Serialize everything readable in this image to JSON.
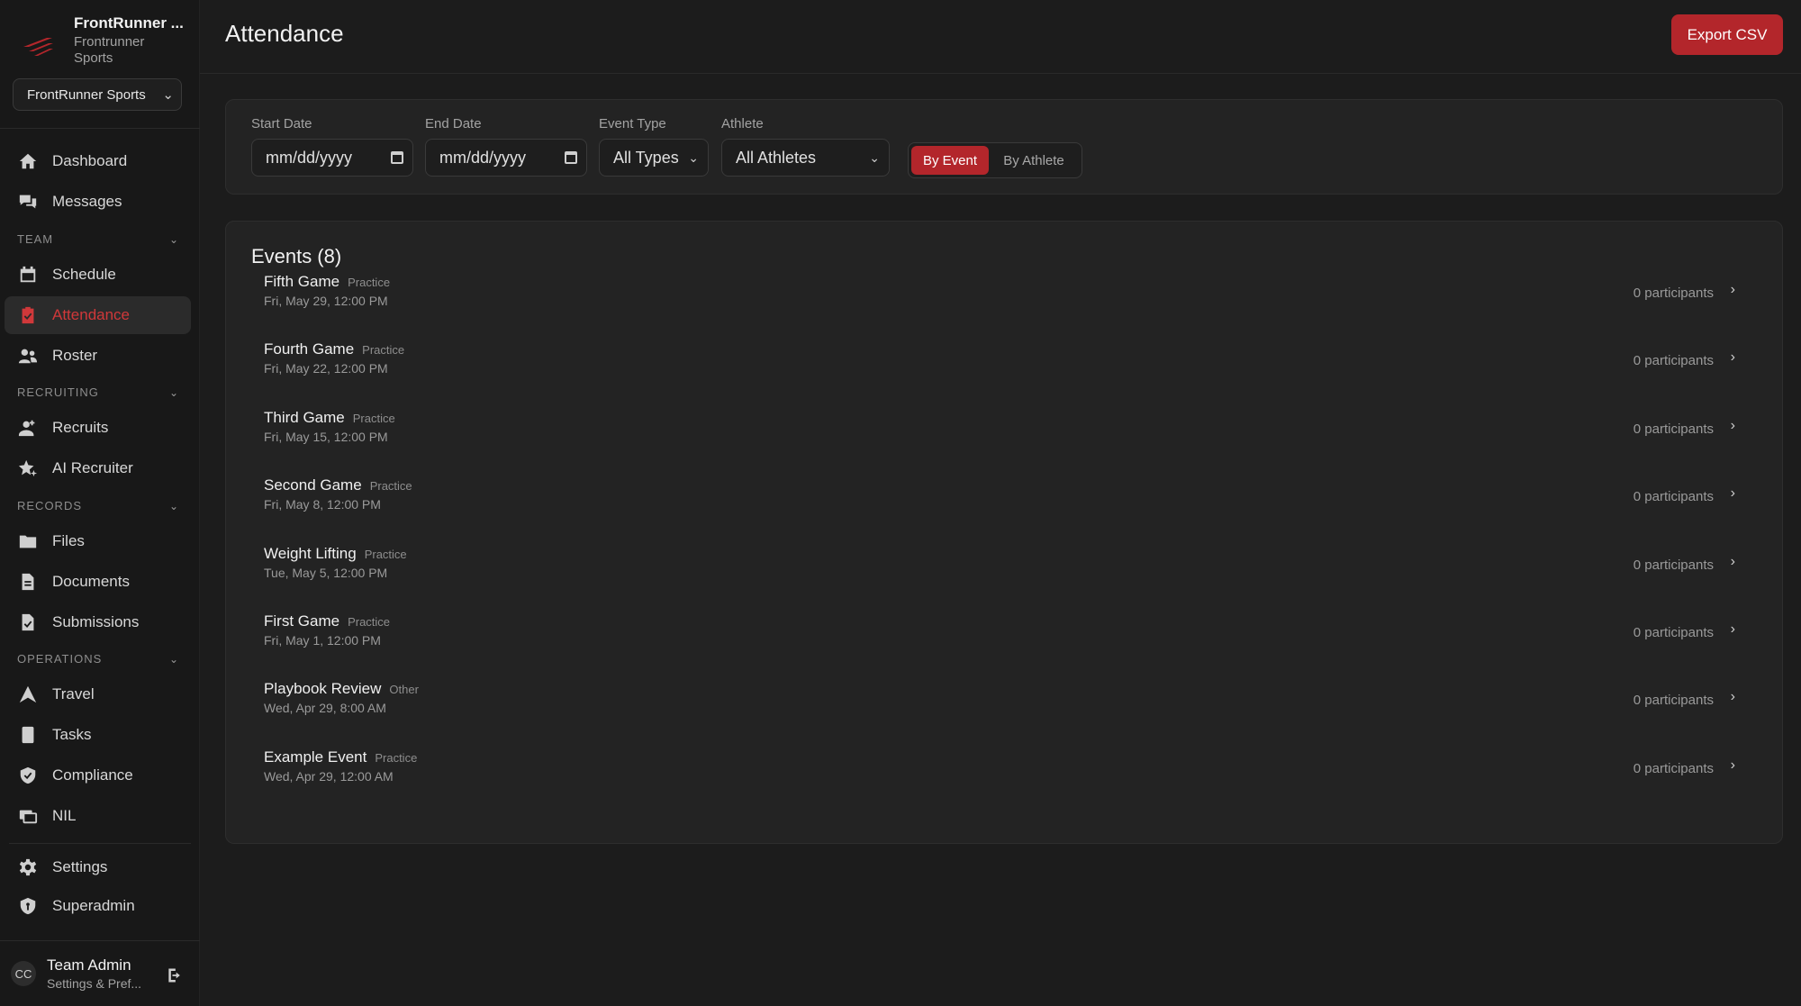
{
  "org": {
    "name": "FrontRunner ...",
    "subtitle": "Frontrunner Sports",
    "selector": "FrontRunner Sports"
  },
  "nav": {
    "dashboard": "Dashboard",
    "messages": "Messages",
    "team_section": "TEAM",
    "schedule": "Schedule",
    "attendance": "Attendance",
    "roster": "Roster",
    "recruiting_section": "RECRUITING",
    "recruits": "Recruits",
    "ai_recruiter": "AI Recruiter",
    "records_section": "RECORDS",
    "files": "Files",
    "documents": "Documents",
    "submissions": "Submissions",
    "operations_section": "OPERATIONS",
    "travel": "Travel",
    "tasks": "Tasks",
    "compliance": "Compliance",
    "nil": "NIL",
    "settings": "Settings",
    "superadmin": "Superadmin"
  },
  "user": {
    "initials": "CC",
    "name": "Team Admin",
    "subtitle": "Settings & Pref..."
  },
  "page": {
    "title": "Attendance",
    "export_label": "Export CSV"
  },
  "filters": {
    "start_label": "Start Date",
    "start_placeholder": "mm/dd/yyyy",
    "end_label": "End Date",
    "end_placeholder": "mm/dd/yyyy",
    "type_label": "Event Type",
    "type_value": "All Types",
    "athlete_label": "Athlete",
    "athlete_value": "All Athletes",
    "view_by_event": "By Event",
    "view_by_athlete": "By Athlete",
    "active_view": "By Event"
  },
  "events": {
    "heading": "Events",
    "count": "(8)",
    "items": [
      {
        "name": "Fifth Game",
        "type": "Practice",
        "date": "Fri, May 29, 12:00 PM",
        "participants": "0 participants"
      },
      {
        "name": "Fourth Game",
        "type": "Practice",
        "date": "Fri, May 22, 12:00 PM",
        "participants": "0 participants"
      },
      {
        "name": "Third Game",
        "type": "Practice",
        "date": "Fri, May 15, 12:00 PM",
        "participants": "0 participants"
      },
      {
        "name": "Second Game",
        "type": "Practice",
        "date": "Fri, May 8, 12:00 PM",
        "participants": "0 participants"
      },
      {
        "name": "Weight Lifting",
        "type": "Practice",
        "date": "Tue, May 5, 12:00 PM",
        "participants": "0 participants"
      },
      {
        "name": "First Game",
        "type": "Practice",
        "date": "Fri, May 1, 12:00 PM",
        "participants": "0 participants"
      },
      {
        "name": "Playbook Review",
        "type": "Other",
        "date": "Wed, Apr 29, 8:00 AM",
        "participants": "0 participants"
      },
      {
        "name": "Example Event",
        "type": "Practice",
        "date": "Wed, Apr 29, 12:00 AM",
        "participants": "0 participants"
      }
    ]
  },
  "colors": {
    "accent": "#b3262b",
    "accent_text": "#d0383a",
    "background": "#1c1c1c",
    "panel": "#232323"
  }
}
